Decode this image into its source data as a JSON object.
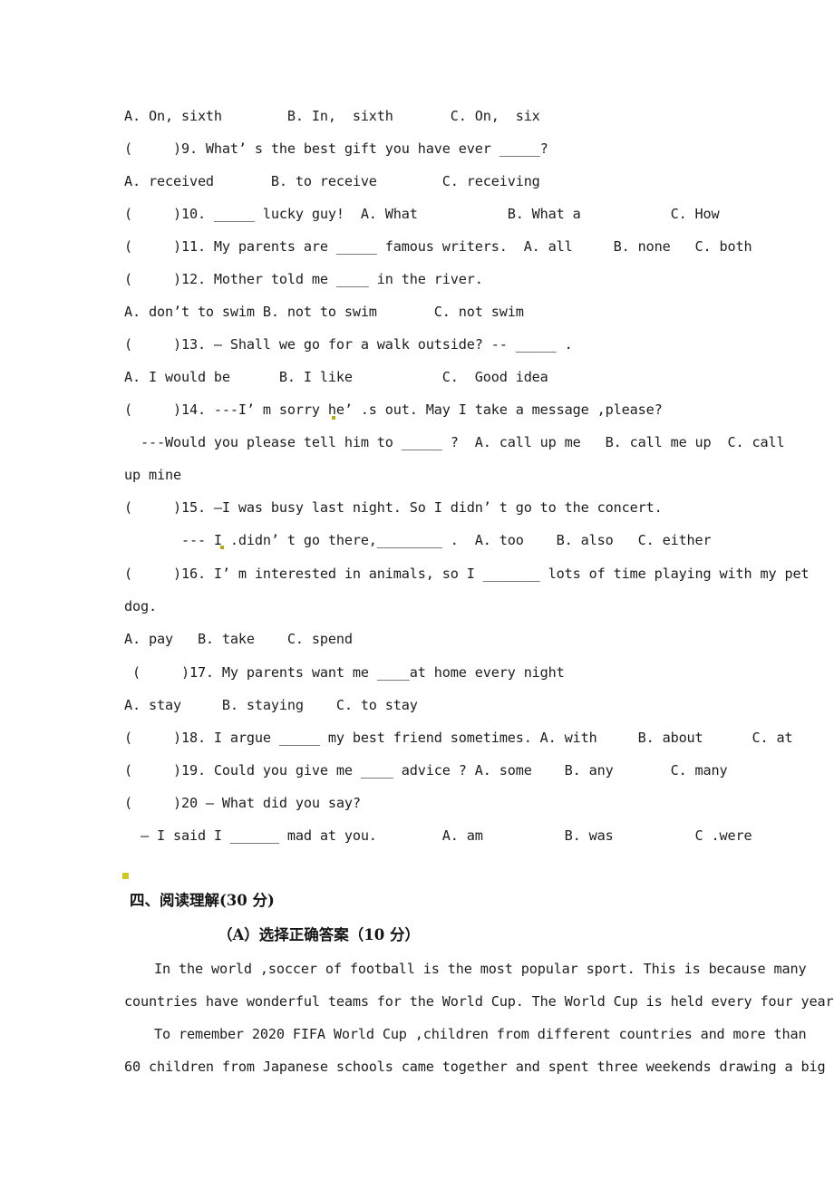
{
  "document": {
    "type": "english-exam-paper",
    "page_background": "#ffffff",
    "text_color": "#1d1d1d",
    "annotation_color": "#b3ad14"
  },
  "questions": [
    {
      "id": "q8-options",
      "text": "A. On, sixth        B. In,  sixth       C. On,  six"
    },
    {
      "id": "q9",
      "text": "(     )9. What’ s the best gift you have ever _____?"
    },
    {
      "id": "q9-options",
      "text": "A. received       B. to receive        C. receiving"
    },
    {
      "id": "q10",
      "text": "(     )10. _____ lucky guy!  A. What           B. What a           C. How"
    },
    {
      "id": "q11",
      "text": "(     )11. My parents are _____ famous writers.  A. all     B. none   C. both"
    },
    {
      "id": "q12",
      "text": "(     )12. Mother told me ____ in the river."
    },
    {
      "id": "q12-options",
      "text": "A. don’t to swim B. not to swim       C. not swim"
    },
    {
      "id": "q13",
      "text": "(     )13. — Shall we go for a walk outside? -- _____ ."
    },
    {
      "id": "q13-options",
      "text": "A. I would be      B. I like           C.  Good idea"
    },
    {
      "id": "q14",
      "text": "(     )14. ---I’ m sorry he’ .s out. May I take a message ,please?"
    },
    {
      "id": "q14-line2",
      "text": "  ---Would you please tell him to _____ ?  A. call up me   B. call me up  C. call"
    },
    {
      "id": "q14-line3",
      "text": "up mine"
    },
    {
      "id": "q15",
      "text": "(     )15. —I was busy last night. So I didn’ t go to the concert."
    },
    {
      "id": "q15-line2",
      "text": "       --- I .didn’ t go there,________ .  A. too    B. also   C. either"
    },
    {
      "id": "q16",
      "text": "(     )16. I’ m interested in animals, so I _______ lots of time playing with my pet"
    },
    {
      "id": "q16-line2",
      "text": "dog."
    },
    {
      "id": "q16-options",
      "text": "A. pay   B. take    C. spend"
    },
    {
      "id": "q17",
      "text": " (     )17. My parents want me ____at home every night"
    },
    {
      "id": "q17-options",
      "text": "A. stay     B. staying    C. to stay"
    },
    {
      "id": "q18",
      "text": "(     )18. I argue _____ my best friend sometimes. A. with     B. about      C. at"
    },
    {
      "id": "q19",
      "text": "(     )19. Could you give me ____ advice ? A. some    B. any       C. many"
    },
    {
      "id": "q20",
      "text": "(     )20 — What did you say?"
    },
    {
      "id": "q20-line2",
      "text": "  — I said I ______ mad at you.        A. am          B. was          C .were"
    }
  ],
  "section_four": {
    "heading": "四、阅读理解(30 分)",
    "subheading": "（A）选择正确答案（10 分）"
  },
  "reading_passage": {
    "lines": [
      "In the world ,soccer of football is the most popular sport. This is because many",
      "countries have wonderful teams for the World Cup. The World Cup is held every four years.",
      "To remember 2020 FIFA World Cup ,children from different countries and more than",
      "60 children from Japanese schools came together and spent three weekends drawing a big"
    ]
  },
  "annotations": [
    {
      "id": "mark-q14",
      "note": "olive spell-check dot before s in he’s"
    },
    {
      "id": "mark-q15",
      "note": "olive spell-check dot before didn’t"
    },
    {
      "id": "mark-section-four",
      "note": "olive square marker above section four heading"
    }
  ]
}
